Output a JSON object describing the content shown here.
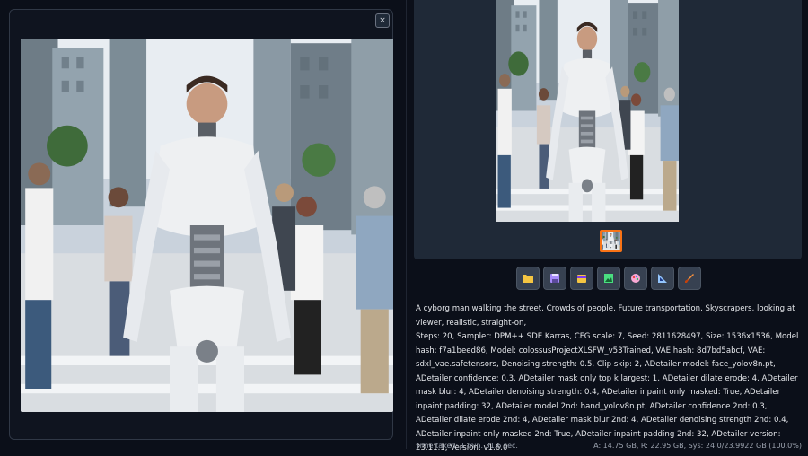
{
  "modal": {
    "close_label": "×",
    "image_alt": "A cyborg man walking the street"
  },
  "gallery": {
    "image_alt": "Generated image preview"
  },
  "toolbar": {
    "buttons": [
      {
        "icon": "folder-icon",
        "color": "#f5c542"
      },
      {
        "icon": "save-icon",
        "color": "#a78bfa"
      },
      {
        "icon": "zip-icon",
        "color": "#f5c542"
      },
      {
        "icon": "img2img-icon",
        "color": "#4ade80"
      },
      {
        "icon": "inpaint-icon",
        "color": "#f472b6"
      },
      {
        "icon": "extras-icon",
        "color": "#60a5fa"
      },
      {
        "icon": "brush-icon",
        "color": "#fb923c"
      }
    ]
  },
  "generation_info": {
    "prompt": "A cyborg man walking the street, Crowds of people, Future transportation, Skyscrapers, looking at viewer, realistic, straight-on,",
    "parameters": "Steps: 20, Sampler: DPM++ SDE Karras, CFG scale: 7, Seed: 2811628497, Size: 1536x1536, Model hash: f7a1beed86, Model: colossusProjectXLSFW_v53Trained, VAE hash: 8d7bd5abcf, VAE: sdxl_vae.safetensors, Denoising strength: 0.5, Clip skip: 2, ADetailer model: face_yolov8n.pt, ADetailer confidence: 0.3, ADetailer mask only top k largest: 1, ADetailer dilate erode: 4, ADetailer mask blur: 4, ADetailer denoising strength: 0.4, ADetailer inpaint only masked: True, ADetailer inpaint padding: 32, ADetailer model 2nd: hand_yolov8n.pt, ADetailer confidence 2nd: 0.3, ADetailer dilate erode 2nd: 4, ADetailer mask blur 2nd: 4, ADetailer denoising strength 2nd: 0.4, ADetailer inpaint only masked 2nd: True, ADetailer inpaint padding 2nd: 32, ADetailer version: 23.11.1, Version: v1.6.0"
  },
  "footer": {
    "time_taken": "Time taken: 1 min. 31.6 sec.",
    "vram": "A: 14.75 GB, R: 22.95 GB, Sys: 24.0/23.9922 GB (100.0%)"
  }
}
